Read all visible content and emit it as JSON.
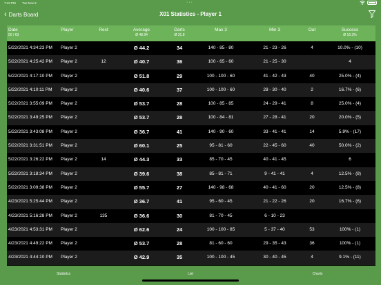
{
  "status_bar": {
    "time": "7:42 PM",
    "date": "Tue Nov 8"
  },
  "nav": {
    "back_label": "Darts Board",
    "title": "X01 Statistics - Player 1"
  },
  "table": {
    "headers": {
      "date": "Date",
      "date_sub": "50 / 63",
      "player": "Player",
      "rest": "Rest",
      "average": "Average",
      "average_sub": "Ø 48.94",
      "darts": "Darts",
      "darts_sub": "Ø 31.8",
      "max3": "Max 3",
      "min3": "Min 3",
      "out": "Out",
      "success": "Success",
      "success_sub": "Ø 16.3%"
    },
    "rows": [
      {
        "date": "5/22/2021 4:34:23 PM",
        "player": "Player 2",
        "rest": "",
        "avg": "Ø 44.2",
        "darts": "34",
        "max3": "140 - 85 - 80",
        "min3": "21 - 23 - 26",
        "out": "4",
        "success": "10.0% - (10)"
      },
      {
        "date": "5/22/2021 4:25:42 PM",
        "player": "Player 2",
        "rest": "12",
        "avg": "Ø 40.7",
        "darts": "36",
        "max3": "100 - 65 - 60",
        "min3": "21 - 25 - 30",
        "out": "",
        "success": "4"
      },
      {
        "date": "5/22/2021 4:17:10 PM",
        "player": "Player 2",
        "rest": "",
        "avg": "Ø 51.8",
        "darts": "29",
        "max3": "100 - 100 - 60",
        "min3": "41 - 42 - 43",
        "out": "40",
        "success": "25.0% - (4)"
      },
      {
        "date": "5/22/2021 4:10:11 PM",
        "player": "Player 2",
        "rest": "",
        "avg": "Ø 40.6",
        "darts": "37",
        "max3": "100 - 100 - 60",
        "min3": "28 - 30 - 40",
        "out": "2",
        "success": "16.7% - (6)"
      },
      {
        "date": "5/22/2021 3:55:09 PM",
        "player": "Player 2",
        "rest": "",
        "avg": "Ø 53.7",
        "darts": "28",
        "max3": "100 - 85 - 85",
        "min3": "24 - 29 - 41",
        "out": "8",
        "success": "25.0% - (4)"
      },
      {
        "date": "5/22/2021 3:49:25 PM",
        "player": "Player 2",
        "rest": "",
        "avg": "Ø 53.7",
        "darts": "28",
        "max3": "100 - 84 - 81",
        "min3": "27 - 28 - 41",
        "out": "20",
        "success": "20.0% - (5)"
      },
      {
        "date": "5/22/2021 3:43:08 PM",
        "player": "Player 2",
        "rest": "",
        "avg": "Ø 36.7",
        "darts": "41",
        "max3": "140 - 90 - 60",
        "min3": "33 - 41 - 41",
        "out": "14",
        "success": "5.9% - (17)"
      },
      {
        "date": "5/22/2021 3:31:51 PM",
        "player": "Player 2",
        "rest": "",
        "avg": "Ø 60.1",
        "darts": "25",
        "max3": "95 - 81 - 60",
        "min3": "22 - 45 - 60",
        "out": "40",
        "success": "50.0% - (2)"
      },
      {
        "date": "5/22/2021 3:26:22 PM",
        "player": "Player 2",
        "rest": "14",
        "avg": "Ø 44.3",
        "darts": "33",
        "max3": "85 - 70 - 45",
        "min3": "40 - 41 - 45",
        "out": "",
        "success": "6"
      },
      {
        "date": "5/22/2021 3:18:34 PM",
        "player": "Player 2",
        "rest": "",
        "avg": "Ø 39.6",
        "darts": "38",
        "max3": "85 - 81 - 71",
        "min3": "9 - 41 - 41",
        "out": "4",
        "success": "12.5% - (8)"
      },
      {
        "date": "5/22/2021 3:09:38 PM",
        "player": "Player 2",
        "rest": "",
        "avg": "Ø 55.7",
        "darts": "27",
        "max3": "140 - 98 - 68",
        "min3": "40 - 41 - 60",
        "out": "20",
        "success": "12.5% - (8)"
      },
      {
        "date": "4/23/2021 5:25:44 PM",
        "player": "Player 2",
        "rest": "",
        "avg": "Ø 36.7",
        "darts": "41",
        "max3": "95 - 60 - 45",
        "min3": "21 - 22 - 26",
        "out": "20",
        "success": "16.7% - (6)"
      },
      {
        "date": "4/23/2021 5:16:28 PM",
        "player": "Player 2",
        "rest": "135",
        "avg": "Ø 36.6",
        "darts": "30",
        "max3": "81 - 70 - 45",
        "min3": "6 - 10 - 23",
        "out": "",
        "success": ""
      },
      {
        "date": "4/23/2021 4:53:31 PM",
        "player": "Player 2",
        "rest": "",
        "avg": "Ø 62.6",
        "darts": "24",
        "max3": "100 - 100 - 85",
        "min3": "5 - 37 - 40",
        "out": "53",
        "success": "100% - (1)"
      },
      {
        "date": "4/23/2021 4:49:22 PM",
        "player": "Player 2",
        "rest": "",
        "avg": "Ø 53.7",
        "darts": "28",
        "max3": "81 - 60 - 60",
        "min3": "29 - 35 - 43",
        "out": "36",
        "success": "100% - (1)"
      },
      {
        "date": "4/23/2021 4:44:10 PM",
        "player": "Player 2",
        "rest": "",
        "avg": "Ø 42.9",
        "darts": "35",
        "max3": "100 - 100 - 45",
        "min3": "30 - 40 - 45",
        "out": "4",
        "success": "9.1% - (11)"
      }
    ]
  },
  "tabs": [
    {
      "label": "Statistics"
    },
    {
      "label": "List"
    },
    {
      "label": "Charts"
    }
  ]
}
